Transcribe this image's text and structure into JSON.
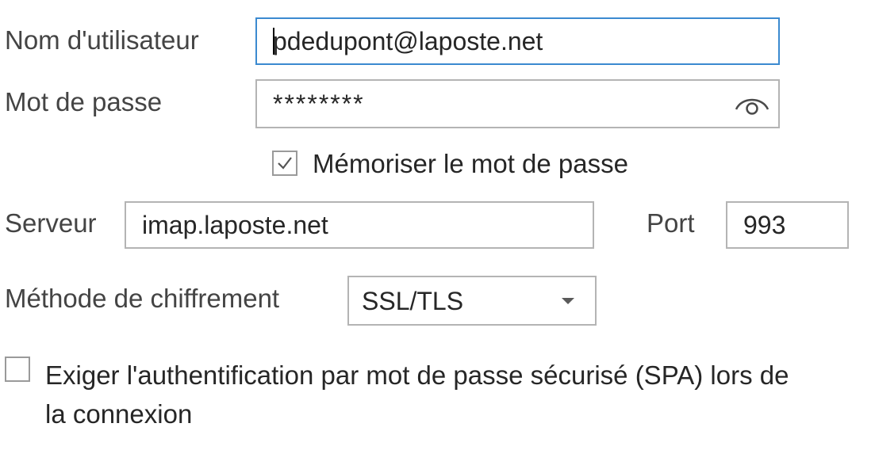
{
  "username": {
    "label": "Nom d'utilisateur",
    "value": "pdedupont@laposte.net"
  },
  "password": {
    "label": "Mot de passe",
    "value": "********",
    "reveal_icon": "eye-icon"
  },
  "remember_password": {
    "label": "Mémoriser le mot de passe",
    "checked": true
  },
  "server": {
    "label": "Serveur",
    "value": "imap.laposte.net"
  },
  "port": {
    "label": "Port",
    "value": "993"
  },
  "encryption": {
    "label": "Méthode de chiffrement",
    "selected": "SSL/TLS"
  },
  "spa": {
    "label_line1": "Exiger l'authentification par mot de passe sécurisé (SPA) lors de",
    "label_line2": "la connexion",
    "checked": false
  },
  "colors": {
    "focus_border": "#3b8ad0",
    "field_border": "#b4b4b4",
    "label_text": "#444444"
  }
}
